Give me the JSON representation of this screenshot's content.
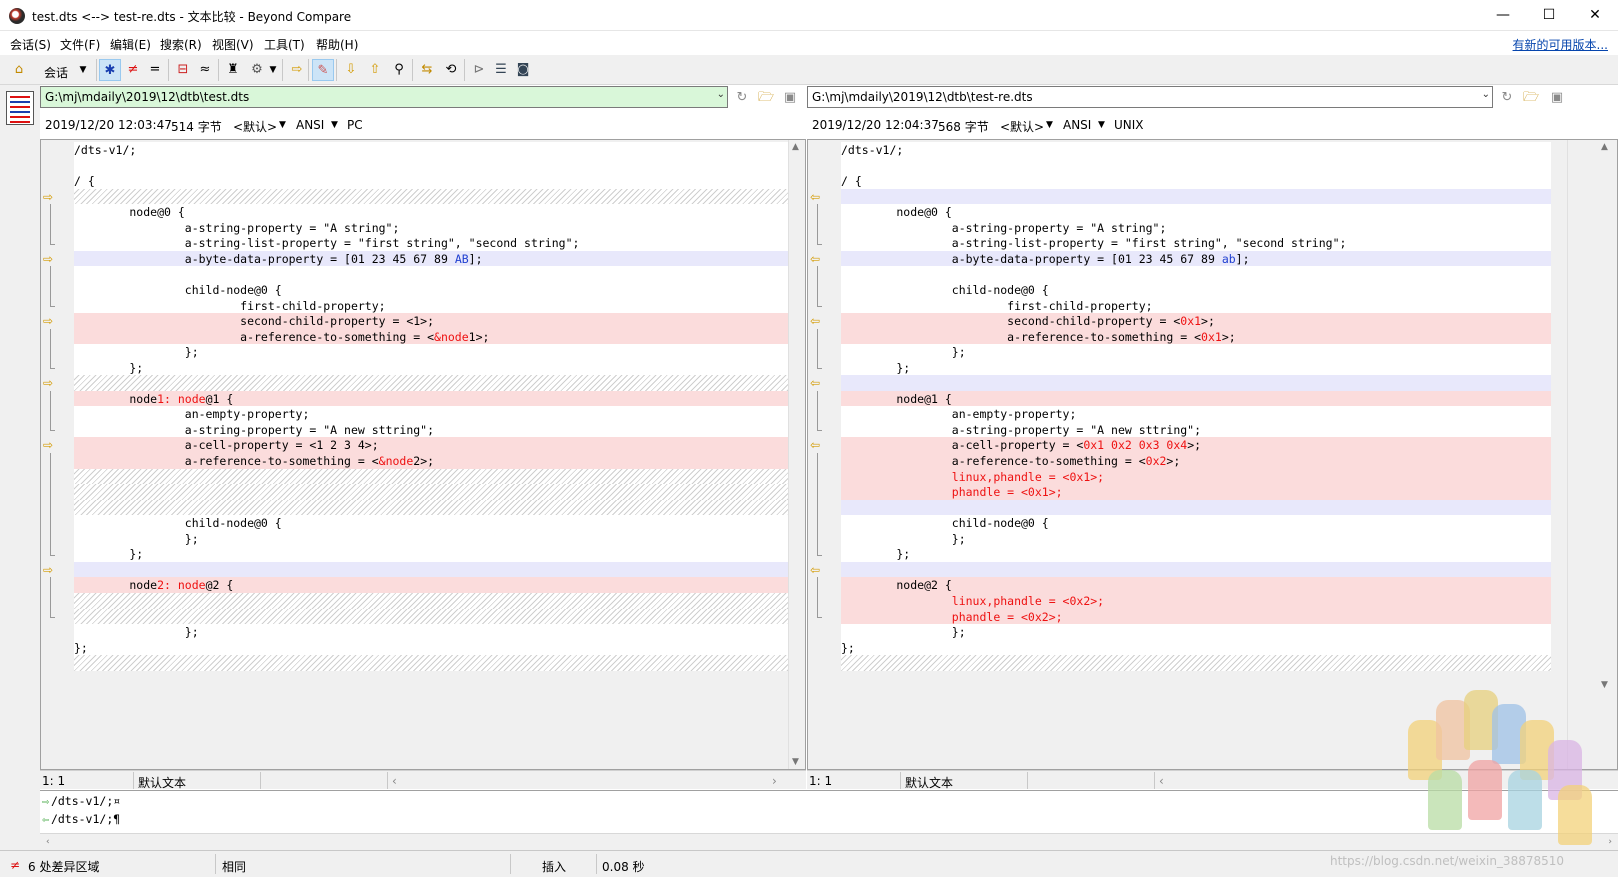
{
  "window": {
    "title": "test.dts <--> test-re.dts - 文本比较 - Beyond Compare",
    "minimize": "—",
    "maximize": "☐",
    "close": "✕"
  },
  "menu": {
    "items": [
      "会话(S)",
      "文件(F)",
      "编辑(E)",
      "搜索(R)",
      "视图(V)",
      "工具(T)",
      "帮助(H)"
    ],
    "new_version": "有新的可用版本..."
  },
  "toolbar": {
    "session_label": "会话"
  },
  "left": {
    "path": "G:\\mj\\mdaily\\2019\\12\\dtb\\test.dts",
    "date": "2019/12/20 12:03:47",
    "size": "514 字节",
    "format": "<默认>",
    "encoding": "ANSI",
    "line_ending": "PC",
    "status_pos": "1: 1",
    "status_format": "默认文本"
  },
  "right": {
    "path": "G:\\mj\\mdaily\\2019\\12\\dtb\\test-re.dts",
    "date": "2019/12/20 12:04:37",
    "size": "568 字节",
    "format": "<默认>",
    "encoding": "ANSI",
    "line_ending": "UNIX",
    "status_pos": "1: 1",
    "status_format": "默认文本"
  },
  "left_lines": [
    {
      "t": "n",
      "p": [
        [
          "/dts-v1/;",
          0
        ]
      ]
    },
    {
      "t": "n",
      "p": [
        [
          "",
          0
        ]
      ]
    },
    {
      "t": "n",
      "p": [
        [
          "/ {",
          0
        ]
      ]
    },
    {
      "t": "hatch",
      "p": []
    },
    {
      "t": "n",
      "p": [
        [
          "        node@0 {",
          0
        ]
      ]
    },
    {
      "t": "n",
      "p": [
        [
          "                a-string-property = \"A string\";",
          0
        ]
      ]
    },
    {
      "t": "n",
      "p": [
        [
          "                a-string-list-property = \"first string\", \"second string\";",
          0
        ]
      ]
    },
    {
      "t": "blue",
      "p": [
        [
          "                a-byte-data-property = [01 23 45 67 89 ",
          0
        ],
        [
          "AB",
          2
        ],
        [
          "];",
          0
        ]
      ]
    },
    {
      "t": "n",
      "p": [
        [
          "",
          0
        ]
      ]
    },
    {
      "t": "n",
      "p": [
        [
          "                child-node@0 {",
          0
        ]
      ]
    },
    {
      "t": "n",
      "p": [
        [
          "                        first-child-property;",
          0
        ]
      ]
    },
    {
      "t": "red",
      "p": [
        [
          "                        second-child-property = <1>;",
          0
        ]
      ]
    },
    {
      "t": "red",
      "p": [
        [
          "                        a-reference-to-something = <",
          0
        ],
        [
          "&node",
          1
        ],
        [
          "1>;",
          0
        ]
      ]
    },
    {
      "t": "n",
      "p": [
        [
          "                };",
          0
        ]
      ]
    },
    {
      "t": "n",
      "p": [
        [
          "        };",
          0
        ]
      ]
    },
    {
      "t": "hatch",
      "p": []
    },
    {
      "t": "red",
      "p": [
        [
          "        node",
          0
        ],
        [
          "1: node",
          1
        ],
        [
          "@1 {",
          0
        ]
      ]
    },
    {
      "t": "n",
      "p": [
        [
          "                an-empty-property;",
          0
        ]
      ]
    },
    {
      "t": "n",
      "p": [
        [
          "                a-string-property = \"A new sttring\";",
          0
        ]
      ]
    },
    {
      "t": "red",
      "p": [
        [
          "                a-cell-property = <1 2 3 4>;",
          0
        ]
      ]
    },
    {
      "t": "red",
      "p": [
        [
          "                a-reference-to-something = <",
          0
        ],
        [
          "&node",
          1
        ],
        [
          "2>;",
          0
        ]
      ]
    },
    {
      "t": "hatch",
      "p": []
    },
    {
      "t": "hatch",
      "p": []
    },
    {
      "t": "hatch",
      "p": []
    },
    {
      "t": "n",
      "p": [
        [
          "                child-node@0 {",
          0
        ]
      ]
    },
    {
      "t": "n",
      "p": [
        [
          "                };",
          0
        ]
      ]
    },
    {
      "t": "n",
      "p": [
        [
          "        };",
          0
        ]
      ]
    },
    {
      "t": "blue",
      "p": []
    },
    {
      "t": "red",
      "p": [
        [
          "        node",
          0
        ],
        [
          "2: node",
          1
        ],
        [
          "@2 {",
          0
        ]
      ]
    },
    {
      "t": "hatch",
      "p": []
    },
    {
      "t": "hatch",
      "p": []
    },
    {
      "t": "n",
      "p": [
        [
          "                };",
          0
        ]
      ]
    },
    {
      "t": "n",
      "p": [
        [
          "};",
          0
        ]
      ]
    },
    {
      "t": "hatch",
      "p": []
    }
  ],
  "right_lines": [
    {
      "t": "n",
      "p": [
        [
          "/dts-v1/;",
          0
        ]
      ]
    },
    {
      "t": "n",
      "p": [
        [
          "",
          0
        ]
      ]
    },
    {
      "t": "n",
      "p": [
        [
          "/ {",
          0
        ]
      ]
    },
    {
      "t": "blue",
      "p": []
    },
    {
      "t": "n",
      "p": [
        [
          "        node@0 {",
          0
        ]
      ]
    },
    {
      "t": "n",
      "p": [
        [
          "                a-string-property = \"A string\";",
          0
        ]
      ]
    },
    {
      "t": "n",
      "p": [
        [
          "                a-string-list-property = \"first string\", \"second string\";",
          0
        ]
      ]
    },
    {
      "t": "blue",
      "p": [
        [
          "                a-byte-data-property = [01 23 45 67 89 ",
          0
        ],
        [
          "ab",
          2
        ],
        [
          "];",
          0
        ]
      ]
    },
    {
      "t": "n",
      "p": [
        [
          "",
          0
        ]
      ]
    },
    {
      "t": "n",
      "p": [
        [
          "                child-node@0 {",
          0
        ]
      ]
    },
    {
      "t": "n",
      "p": [
        [
          "                        first-child-property;",
          0
        ]
      ]
    },
    {
      "t": "red",
      "p": [
        [
          "                        second-child-property = <",
          0
        ],
        [
          "0x1",
          1
        ],
        [
          ">;",
          0
        ]
      ]
    },
    {
      "t": "red",
      "p": [
        [
          "                        a-reference-to-something = <",
          0
        ],
        [
          "0x1",
          1
        ],
        [
          ">;",
          0
        ]
      ]
    },
    {
      "t": "n",
      "p": [
        [
          "                };",
          0
        ]
      ]
    },
    {
      "t": "n",
      "p": [
        [
          "        };",
          0
        ]
      ]
    },
    {
      "t": "blue",
      "p": []
    },
    {
      "t": "red",
      "p": [
        [
          "        node@1 {",
          0
        ]
      ]
    },
    {
      "t": "n",
      "p": [
        [
          "                an-empty-property;",
          0
        ]
      ]
    },
    {
      "t": "n",
      "p": [
        [
          "                a-string-property = \"A new sttring\";",
          0
        ]
      ]
    },
    {
      "t": "red",
      "p": [
        [
          "                a-cell-property = <",
          0
        ],
        [
          "0x1 0x2 0x3 0x4",
          1
        ],
        [
          ">;",
          0
        ]
      ]
    },
    {
      "t": "red",
      "p": [
        [
          "                a-reference-to-something = <",
          0
        ],
        [
          "0x2",
          1
        ],
        [
          ">;",
          0
        ]
      ]
    },
    {
      "t": "red",
      "p": [
        [
          "                linux,phandle = <0x1>;",
          1
        ]
      ]
    },
    {
      "t": "red",
      "p": [
        [
          "                phandle = <0x1>;",
          1
        ]
      ]
    },
    {
      "t": "blue",
      "p": []
    },
    {
      "t": "n",
      "p": [
        [
          "                child-node@0 {",
          0
        ]
      ]
    },
    {
      "t": "n",
      "p": [
        [
          "                };",
          0
        ]
      ]
    },
    {
      "t": "n",
      "p": [
        [
          "        };",
          0
        ]
      ]
    },
    {
      "t": "blue",
      "p": []
    },
    {
      "t": "red",
      "p": [
        [
          "        node@2 {",
          0
        ]
      ]
    },
    {
      "t": "red",
      "p": [
        [
          "                linux,phandle = <0x2>;",
          1
        ]
      ]
    },
    {
      "t": "red",
      "p": [
        [
          "                phandle = <0x2>;",
          1
        ]
      ]
    },
    {
      "t": "n",
      "p": [
        [
          "                };",
          0
        ]
      ]
    },
    {
      "t": "n",
      "p": [
        [
          "};",
          0
        ]
      ]
    },
    {
      "t": "hatch",
      "p": []
    }
  ],
  "diff_arrow_rows": [
    3,
    7,
    11,
    15,
    19,
    27
  ],
  "preview": {
    "line1": "/dts-v1/;¤",
    "line2": "/dts-v1/;¶"
  },
  "status": {
    "diff_count": "6 处差异区域",
    "same": "相同",
    "mode": "插入",
    "time": "0.08 秒"
  },
  "watermark": "https://blog.csdn.net/weixin_38878510",
  "colors": {
    "diff_red_bg": "#fbdcdc",
    "diff_blue_bg": "#e8e8fb",
    "diff_text_red": "#ee1111",
    "diff_text_blue": "#1f3fd0",
    "left_path_bg": "#d9f7d9",
    "arrow": "#d39a00",
    "link": "#0645ad"
  }
}
